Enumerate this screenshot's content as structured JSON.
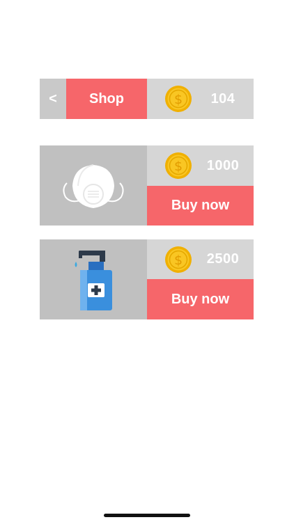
{
  "header": {
    "back_label": "<",
    "title": "Shop",
    "coin_balance": "104"
  },
  "items": [
    {
      "name": "mask",
      "icon": "face-mask-icon",
      "price": "1000",
      "buy_label": "Buy now"
    },
    {
      "name": "sanitizer",
      "icon": "hand-sanitizer-icon",
      "price": "2500",
      "buy_label": "Buy now"
    }
  ],
  "colors": {
    "accent": "#f6666a",
    "panel_light": "#d6d6d6",
    "panel_dark": "#c0c0c0",
    "back_button": "#c9c9c9",
    "coin_gold": "#f5c21a"
  }
}
